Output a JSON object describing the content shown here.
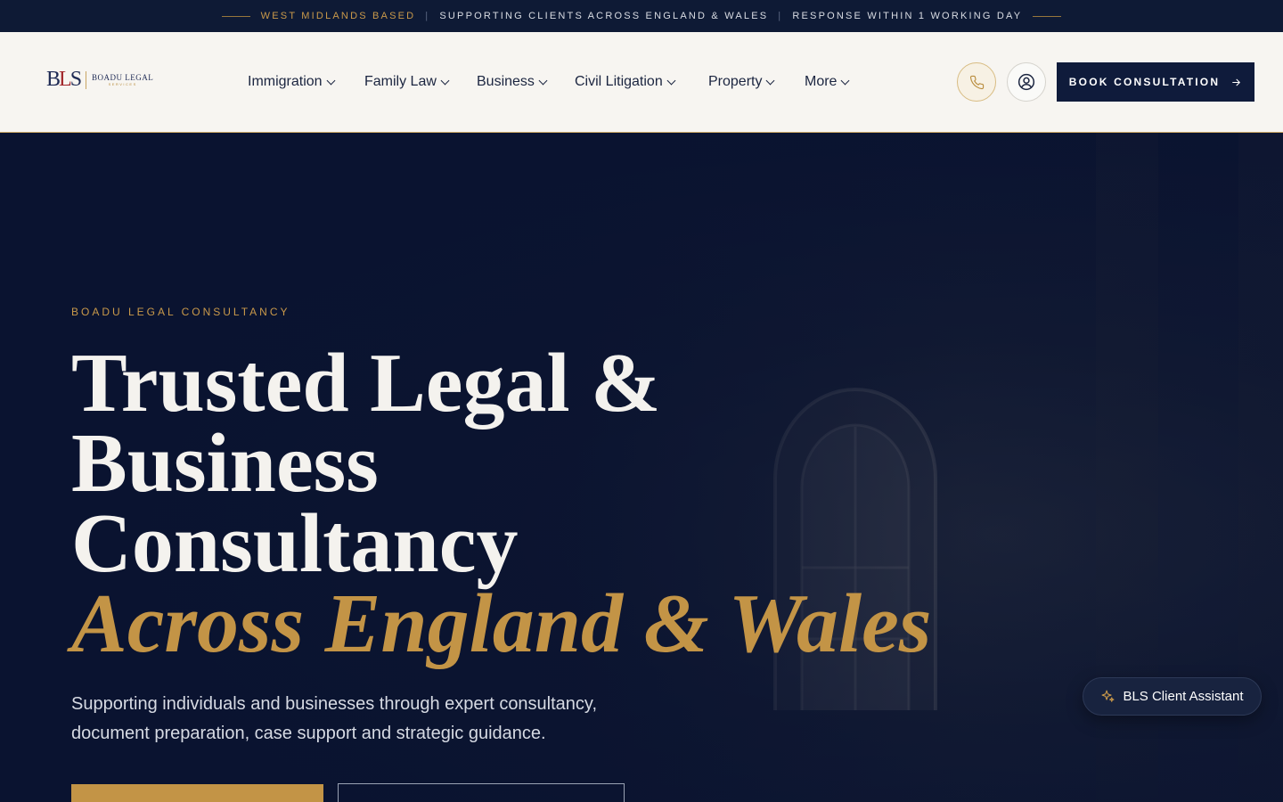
{
  "topbar": {
    "item1": "WEST MIDLANDS BASED",
    "item2": "SUPPORTING CLIENTS ACROSS ENGLAND & WALES",
    "item3": "RESPONSE WITHIN 1 WORKING DAY",
    "separator": "|"
  },
  "brand": {
    "mark_b": "B",
    "mark_l": "L",
    "mark_s": "S",
    "name": "BOADU LEGAL",
    "sub": "SERVICES"
  },
  "nav": {
    "items": [
      {
        "label": "Immigration"
      },
      {
        "label": "Family Law"
      },
      {
        "label": "Business"
      },
      {
        "label": "Civil Litigation"
      },
      {
        "label": "Property"
      },
      {
        "label": "More"
      }
    ]
  },
  "header_actions": {
    "phone_icon": "phone-icon",
    "account_icon": "user-circle-icon",
    "book_label": "BOOK CONSULTATION",
    "book_icon": "arrow-right-icon"
  },
  "hero": {
    "eyebrow": "BOADU LEGAL CONSULTANCY",
    "title_line1": "Trusted Legal &",
    "title_line2": "Business",
    "title_line3": "Consultancy",
    "title_line4": "Across England & Wales",
    "description": "Supporting individuals and businesses through expert consultancy, document preparation, case support and strategic guidance."
  },
  "assistant": {
    "label": "BLS Client Assistant",
    "icon": "sparkles-icon"
  },
  "colors": {
    "navy": "#0f1b3b",
    "gold": "#c39446",
    "cream": "#f7f5f1"
  }
}
